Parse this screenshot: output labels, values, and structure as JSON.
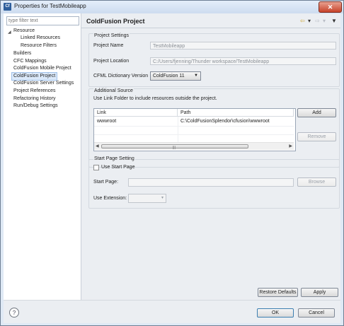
{
  "window": {
    "title": "Properties for TestMobileapp",
    "close_label": "✕"
  },
  "filter": {
    "placeholder": "type filter text"
  },
  "tree": {
    "items": [
      {
        "label": "Resource"
      },
      {
        "label": "Linked Resources"
      },
      {
        "label": "Resource Filters"
      },
      {
        "label": "Builders"
      },
      {
        "label": "CFC Mappings"
      },
      {
        "label": "ColdFusion Mobile Project"
      },
      {
        "label": "ColdFusion Project"
      },
      {
        "label": "ColdFusion Server Settings"
      },
      {
        "label": "Project References"
      },
      {
        "label": "Refactoring History"
      },
      {
        "label": "Run/Debug Settings"
      }
    ]
  },
  "page": {
    "title": "ColdFusion Project",
    "project_settings": {
      "heading": "Project Settings",
      "name_label": "Project Name",
      "name_value": "TestMobileapp",
      "location_label": "Project Location",
      "location_value": "C:/Users/fjenning/Thunder workspace/TestMobileapp",
      "dictionary_label": "CFML Dictionary Version",
      "dictionary_value": "ColdFusion 11"
    },
    "additional_source": {
      "heading": "Additional Source",
      "description": "Use Link Folder to include resources outside the project.",
      "columns": [
        "Link",
        "Path"
      ],
      "rows": [
        {
          "link": "wwwroot",
          "path": "C:\\ColdFusionSplendor\\cfusion\\wwwroot"
        }
      ],
      "add_label": "Add",
      "remove_label": "Remove"
    },
    "start_page": {
      "heading": "Start Page Setting",
      "use_label": "Use Start Page",
      "use_checked": false,
      "page_label": "Start Page:",
      "page_value": "",
      "browse_label": "Browse",
      "extension_label": "Use Extension:",
      "extension_value": ""
    },
    "restore_label": "Restore Defaults",
    "apply_label": "Apply"
  },
  "footer": {
    "ok_label": "OK",
    "cancel_label": "Cancel",
    "help_glyph": "?"
  }
}
